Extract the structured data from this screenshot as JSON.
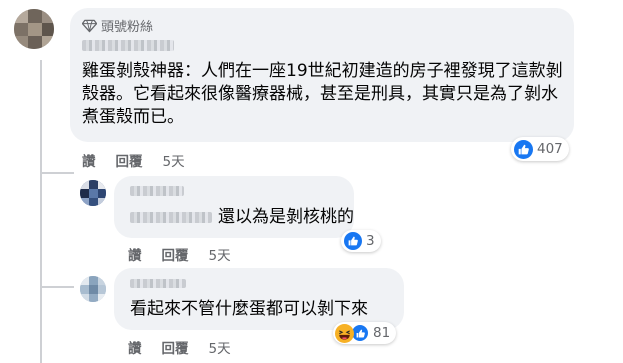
{
  "comment_main": {
    "badge_label": "頭號粉絲",
    "text": "雞蛋剝殼神器：人們在一座19世紀初建造的房子裡發現了這款剝殼器。它看起來很像醫療器械，甚至是刑具，其實只是為了剝水煮蛋殼而已。",
    "like_label": "讚",
    "reply_label": "回覆",
    "time": "5天",
    "reaction_count": "407",
    "reaction_icon": "thumbs-up-icon"
  },
  "reply_1": {
    "text": "還以為是剝核桃的",
    "like_label": "讚",
    "reply_label": "回覆",
    "time": "5天",
    "reaction_count": "3",
    "reaction_icon": "thumbs-up-icon"
  },
  "reply_2": {
    "text": "看起來不管什麼蛋都可以剝下來",
    "like_label": "讚",
    "reply_label": "回覆",
    "time": "5天",
    "reaction_count": "81",
    "reaction_icons": [
      "haha-icon",
      "thumbs-up-icon"
    ]
  },
  "colors": {
    "bubble_bg": "#f0f2f5",
    "meta_text": "#65676b",
    "like_blue": "#1877f2",
    "haha_yellow": "#f7b125"
  }
}
